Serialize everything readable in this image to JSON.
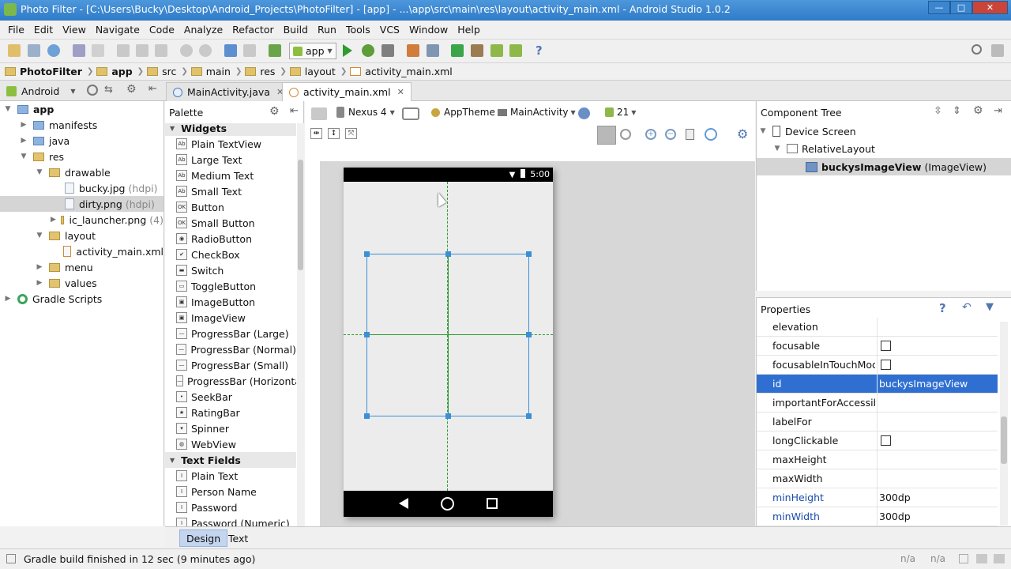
{
  "window": {
    "title": "Photo Filter - [C:\\Users\\Bucky\\Desktop\\Android_Projects\\PhotoFilter] - [app] - ...\\app\\src\\main\\res\\layout\\activity_main.xml - Android Studio 1.0.2",
    "min_label": "—",
    "max_label": "□",
    "close_label": "✕"
  },
  "menu": [
    "File",
    "Edit",
    "View",
    "Navigate",
    "Code",
    "Analyze",
    "Refactor",
    "Build",
    "Run",
    "Tools",
    "VCS",
    "Window",
    "Help"
  ],
  "toolbar": {
    "run_config": "app"
  },
  "breadcrumbs": [
    "PhotoFilter",
    "app",
    "src",
    "main",
    "res",
    "layout",
    "activity_main.xml"
  ],
  "project_panel": {
    "view_mode": "Android"
  },
  "editor_tabs": [
    {
      "label": "MainActivity.java",
      "icon": "java-class-icon"
    },
    {
      "label": "activity_main.xml",
      "icon": "xml-layout-icon"
    }
  ],
  "project_tree": [
    {
      "label": "app",
      "note": ""
    },
    {
      "label": "manifests",
      "note": ""
    },
    {
      "label": "java",
      "note": ""
    },
    {
      "label": "res",
      "note": ""
    },
    {
      "label": "drawable",
      "note": ""
    },
    {
      "label": "bucky.jpg",
      "note": "(hdpi)"
    },
    {
      "label": "dirty.png",
      "note": "(hdpi)"
    },
    {
      "label": "ic_launcher.png",
      "note": "(4)"
    },
    {
      "label": "layout",
      "note": ""
    },
    {
      "label": "activity_main.xml",
      "note": ""
    },
    {
      "label": "menu",
      "note": ""
    },
    {
      "label": "values",
      "note": ""
    },
    {
      "label": "Gradle Scripts",
      "note": ""
    }
  ],
  "palette": {
    "title": "Palette",
    "items": [
      {
        "label": "Widgets",
        "icon": "",
        "category": true
      },
      {
        "label": "Plain TextView",
        "icon": "Ab"
      },
      {
        "label": "Large Text",
        "icon": "Ab"
      },
      {
        "label": "Medium Text",
        "icon": "Ab"
      },
      {
        "label": "Small Text",
        "icon": "Ab"
      },
      {
        "label": "Button",
        "icon": "OK"
      },
      {
        "label": "Small Button",
        "icon": "OK"
      },
      {
        "label": "RadioButton",
        "icon": "◉"
      },
      {
        "label": "CheckBox",
        "icon": "✔"
      },
      {
        "label": "Switch",
        "icon": "▬"
      },
      {
        "label": "ToggleButton",
        "icon": "▭"
      },
      {
        "label": "ImageButton",
        "icon": "▣"
      },
      {
        "label": "ImageView",
        "icon": "▣"
      },
      {
        "label": "ProgressBar (Large)",
        "icon": "—"
      },
      {
        "label": "ProgressBar (Normal)",
        "icon": "—"
      },
      {
        "label": "ProgressBar (Small)",
        "icon": "—"
      },
      {
        "label": "ProgressBar (Horizontal)",
        "icon": "—"
      },
      {
        "label": "SeekBar",
        "icon": "•"
      },
      {
        "label": "RatingBar",
        "icon": "★"
      },
      {
        "label": "Spinner",
        "icon": "▾"
      },
      {
        "label": "WebView",
        "icon": "◍"
      },
      {
        "label": "Text Fields",
        "icon": "",
        "category": true
      },
      {
        "label": "Plain Text",
        "icon": "I"
      },
      {
        "label": "Person Name",
        "icon": "I"
      },
      {
        "label": "Password",
        "icon": "I"
      },
      {
        "label": "Password (Numeric)",
        "icon": "I"
      }
    ]
  },
  "designer_toolbar": {
    "device": "Nexus 4",
    "theme": "AppTheme",
    "activity": "MainActivity",
    "api": "21"
  },
  "phone": {
    "clock": "5:00"
  },
  "component_tree": {
    "title": "Component Tree",
    "nodes": [
      {
        "label": "Device Screen",
        "type": ""
      },
      {
        "label": "RelativeLayout",
        "type": ""
      },
      {
        "label": "buckysImageView",
        "type": "(ImageView)"
      }
    ]
  },
  "properties": {
    "title": "Properties",
    "rows": [
      {
        "key": "elevation",
        "value": "",
        "checkbox": false
      },
      {
        "key": "focusable",
        "value": "",
        "checkbox": true
      },
      {
        "key": "focusableInTouchMode",
        "value": "",
        "checkbox": true
      },
      {
        "key": "id",
        "value": "buckysImageView",
        "checkbox": false,
        "selected": true
      },
      {
        "key": "importantForAccessibility",
        "value": "",
        "checkbox": false
      },
      {
        "key": "labelFor",
        "value": "",
        "checkbox": false
      },
      {
        "key": "longClickable",
        "value": "",
        "checkbox": true
      },
      {
        "key": "maxHeight",
        "value": "",
        "checkbox": false
      },
      {
        "key": "maxWidth",
        "value": "",
        "checkbox": false
      },
      {
        "key": "minHeight",
        "value": "300dp",
        "checkbox": false,
        "modified": true
      },
      {
        "key": "minWidth",
        "value": "300dp",
        "checkbox": false,
        "modified": true
      }
    ]
  },
  "bottom_tabs": [
    "Design",
    "Text"
  ],
  "status": {
    "message": "Gradle build finished in 12 sec (9 minutes ago)",
    "pos1": "n/a",
    "pos2": "n/a"
  },
  "colors": {
    "titlebar": "#3b86d1",
    "selection": "#2f6fd1",
    "guide": "#2e9c2e",
    "bounds": "#3a8fd6"
  }
}
